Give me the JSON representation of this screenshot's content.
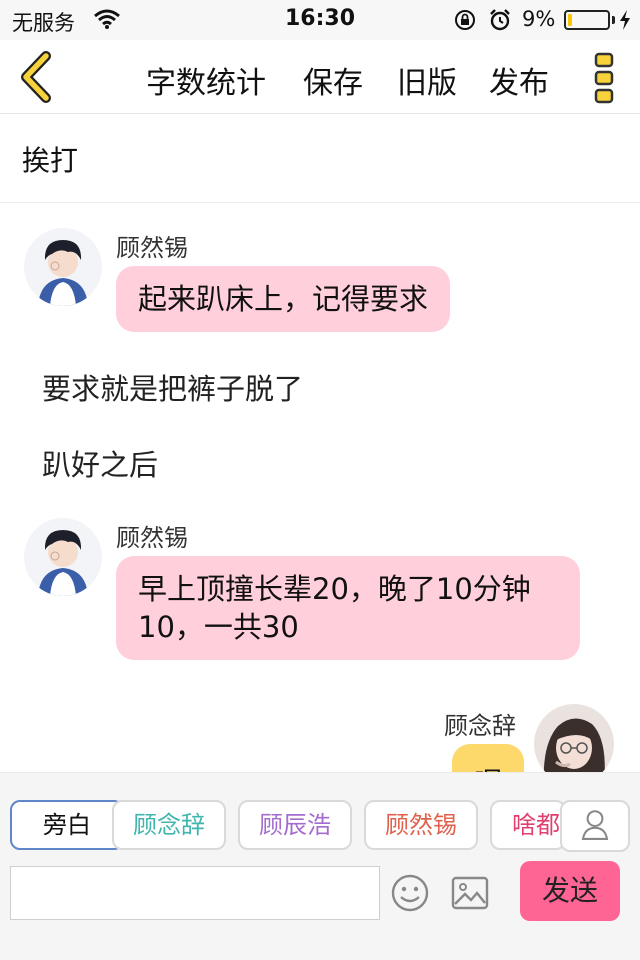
{
  "status_bar": {
    "carrier": "无服务",
    "time": "16:30",
    "battery_text": "9%",
    "battery_level": 0.09,
    "icons": [
      "wifi-icon",
      "orientation-lock-icon",
      "alarm-icon",
      "battery-icon",
      "charging-bolt-icon"
    ]
  },
  "nav": {
    "word_count": "字数统计",
    "save": "保存",
    "old_version": "旧版",
    "publish": "发布",
    "icons": [
      "back-chevron-icon",
      "more-vertical-icon"
    ],
    "accent": "#f7d23a"
  },
  "title": "挨打",
  "messages": [
    {
      "type": "bubble",
      "side": "left",
      "sender": "顾然锡",
      "text": "起来趴床上，记得要求"
    },
    {
      "type": "narration",
      "text": "要求就是把裤子脱了"
    },
    {
      "type": "narration",
      "text": "趴好之后"
    },
    {
      "type": "bubble",
      "side": "left",
      "sender": "顾然锡",
      "text": "早上顶撞长辈20，晚了10分钟10，一共30"
    },
    {
      "type": "bubble",
      "side": "right",
      "sender": "顾念辞",
      "text": "嗯"
    }
  ],
  "roles": [
    {
      "label": "旁白",
      "color": "#111111"
    },
    {
      "label": "顾念辞",
      "color": "#3fb6ad"
    },
    {
      "label": "顾辰浩",
      "color": "#a56ccf"
    },
    {
      "label": "顾然锡",
      "color": "#e0604b"
    },
    {
      "label": "啥都",
      "color": "#e0406e"
    }
  ],
  "composer": {
    "input_value": "",
    "send": "发送",
    "send_color": "#ff6594",
    "icons": [
      "emoji-icon",
      "image-icon",
      "profile-icon"
    ]
  }
}
